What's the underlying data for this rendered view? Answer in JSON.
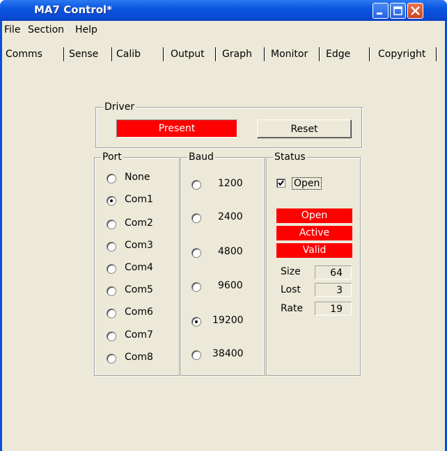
{
  "window": {
    "title": "MA7 Control*"
  },
  "menu": [
    "File",
    "Section",
    "Help"
  ],
  "tabs": [
    "Comms",
    "Sense",
    "Calib",
    "Output",
    "Graph",
    "Monitor",
    "Edge",
    "Copyright"
  ],
  "driver": {
    "label": "Driver",
    "status": "Present",
    "reset_label": "Reset"
  },
  "port": {
    "label": "Port",
    "options": [
      "None",
      "Com1",
      "Com2",
      "Com3",
      "Com4",
      "Com5",
      "Com6",
      "Com7",
      "Com8"
    ],
    "selected": "Com1"
  },
  "baud": {
    "label": "Baud",
    "options": [
      "1200",
      "2400",
      "4800",
      "9600",
      "19200",
      "38400"
    ],
    "selected": "19200"
  },
  "status": {
    "label": "Status",
    "open_checkbox_label": "Open",
    "open_checked": true,
    "indicators": [
      "Open",
      "Active",
      "Valid"
    ],
    "stats": [
      {
        "label": "Size",
        "value": "64"
      },
      {
        "label": "Lost",
        "value": "3"
      },
      {
        "label": "Rate",
        "value": "19"
      }
    ]
  },
  "colors": {
    "indicator_red": "#ff0000",
    "dialog_bg": "#ece9d8",
    "title_blue": "#0b56e0"
  }
}
